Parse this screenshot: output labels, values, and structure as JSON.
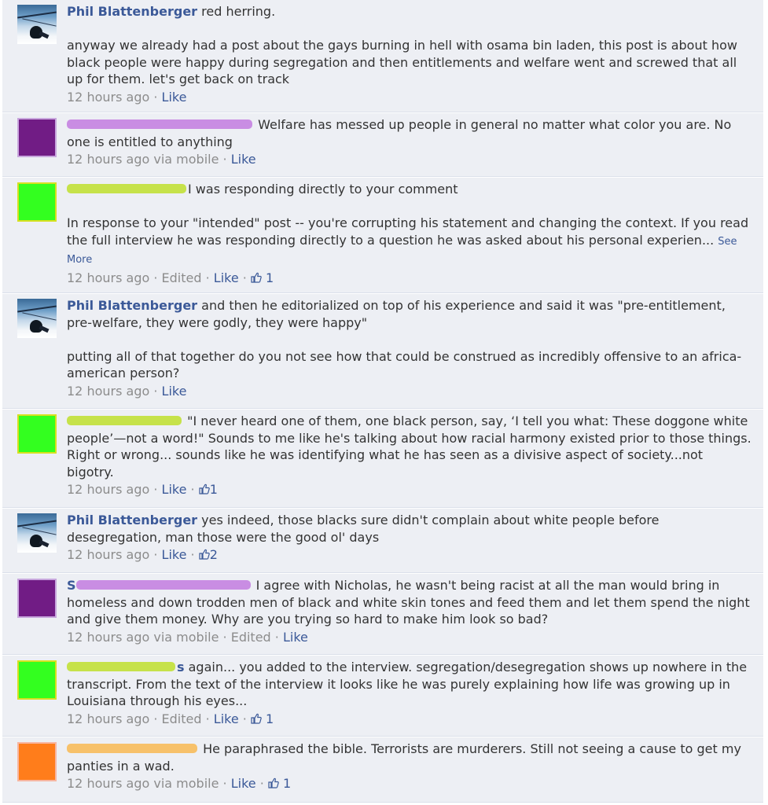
{
  "comments": [
    {
      "author": "Phil Blattenberger",
      "paragraphs": [
        "red herring.",
        "anyway we already had a post about the gays burning in hell with osama bin laden, this post is about how black people were happy during segregation and then entitlements and welfare went and screwed that all up for them. let's get back on track"
      ],
      "time": "12 hours ago",
      "like": "Like"
    },
    {
      "author": "",
      "paragraphs": [
        "Welfare has messed up people in general no matter what color you are. No one is entitled to anything"
      ],
      "time": "12 hours ago",
      "via": "via mobile",
      "like": "Like"
    },
    {
      "author": "",
      "paragraphs": [
        "I was responding directly to your comment",
        "In response to your \"intended\" post -- you're corrupting his statement and changing the context. If you read the full interview he was responding directly to a question he was asked about his personal experien..."
      ],
      "see_more": "See More",
      "time": "12 hours ago",
      "edited": "Edited",
      "like": "Like",
      "likes": "1"
    },
    {
      "author": "Phil Blattenberger",
      "paragraphs": [
        "and then he editorialized on top of his experience and said it was \"pre-entitlement, pre-welfare, they were godly, they were happy\"",
        "putting all of that together do you not see how that could be construed as incredibly offensive to an africa-american person?"
      ],
      "time": "12 hours ago",
      "like": "Like"
    },
    {
      "author": "",
      "paragraphs": [
        "\"I never heard one of them, one black person, say, ‘I tell you what: These doggone white people’—not a word!\" Sounds to me like he's talking about how racial harmony existed prior to those things. Right or wrong... sounds like he was identifying what he has seen as a divisive aspect of society...not bigotry."
      ],
      "time": "12 hours ago",
      "like": "Like",
      "likes": "1"
    },
    {
      "author": "Phil Blattenberger",
      "paragraphs": [
        "yes indeed, those blacks sure didn't complain about white people before desegregation, man those were the good ol' days"
      ],
      "time": "12 hours ago",
      "like": "Like",
      "likes": "2"
    },
    {
      "author": "S",
      "paragraphs": [
        "I agree with Nicholas, he wasn't being racist at all the man would bring in homeless and down trodden men of black and white skin tones and feed them and let them spend the night and give them money. Why are you trying so hard to make him look so bad?"
      ],
      "time": "12 hours ago",
      "via": "via mobile",
      "edited": "Edited",
      "like": "Like"
    },
    {
      "author": "",
      "author_tail": "s",
      "paragraphs": [
        "again... you added to the interview. segregation/desegregation shows up nowhere in the transcript. From the text of the interview it looks like he was purely explaining how life was growing up in Louisiana through his eyes..."
      ],
      "time": "12 hours ago",
      "edited": "Edited",
      "like": "Like",
      "likes": "1"
    },
    {
      "author": "",
      "paragraphs": [
        "He paraphrased the bible. Terrorists are murderers. Still not seeing a cause to get my panties in a wad."
      ],
      "time": "12 hours ago",
      "via": "via mobile",
      "like": "Like",
      "likes": "1"
    }
  ],
  "separator": " · ",
  "colors": {
    "link": "#3b5998",
    "meta": "#8c8c8c",
    "background": "#edeff4"
  }
}
